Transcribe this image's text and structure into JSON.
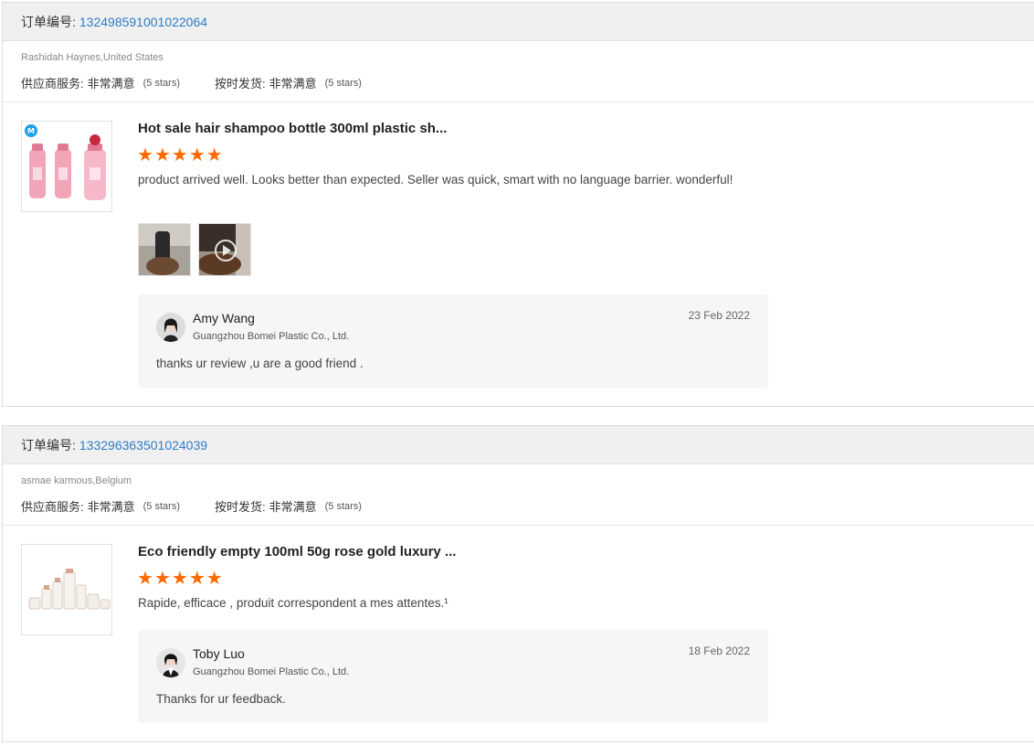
{
  "reviews": [
    {
      "order_label": "订单编号",
      "order_sep": ":",
      "order_number": "132498591001022064",
      "buyer": "Rashidah Haynes,United States",
      "ratings": [
        {
          "label": "供应商服务:",
          "value": "非常满意",
          "stars": "(5 stars)"
        },
        {
          "label": "按时发货:",
          "value": "非常满意",
          "stars": "(5 stars)"
        }
      ],
      "product_title": "Hot sale hair shampoo bottle 300ml plastic sh...",
      "star_rating": 5,
      "star_icon": "★",
      "comment": "product arrived well. Looks better than expected.  Seller was quick, smart with no language barrier. wonderful!",
      "media": [
        "photo",
        "video"
      ],
      "reply": {
        "name": "Amy Wang",
        "company": "Guangzhou Bomei Plastic Co., Ltd.",
        "date": "23 Feb 2022",
        "text": "thanks ur  review ,u are a good friend ."
      }
    },
    {
      "order_label": "订单编号",
      "order_sep": ":",
      "order_number": "133296363501024039",
      "buyer": "asmae karmous,Belgium",
      "ratings": [
        {
          "label": "供应商服务:",
          "value": "非常满意",
          "stars": "(5 stars)"
        },
        {
          "label": "按时发货:",
          "value": "非常满意",
          "stars": "(5 stars)"
        }
      ],
      "product_title": "Eco friendly empty 100ml 50g rose gold luxury ...",
      "star_rating": 5,
      "star_icon": "★",
      "comment": "Rapide, efficace , produit correspondent a mes attentes.¹",
      "reply": {
        "name": "Toby Luo",
        "company": "Guangzhou Bomei Plastic Co., Ltd.",
        "date": "18 Feb 2022",
        "text": "Thanks for ur feedback."
      }
    }
  ],
  "colors": {
    "star": "#ff6a00",
    "link": "#2e7cc4",
    "header_bg": "#f0f0f0",
    "reply_bg": "#f5f6f8"
  }
}
